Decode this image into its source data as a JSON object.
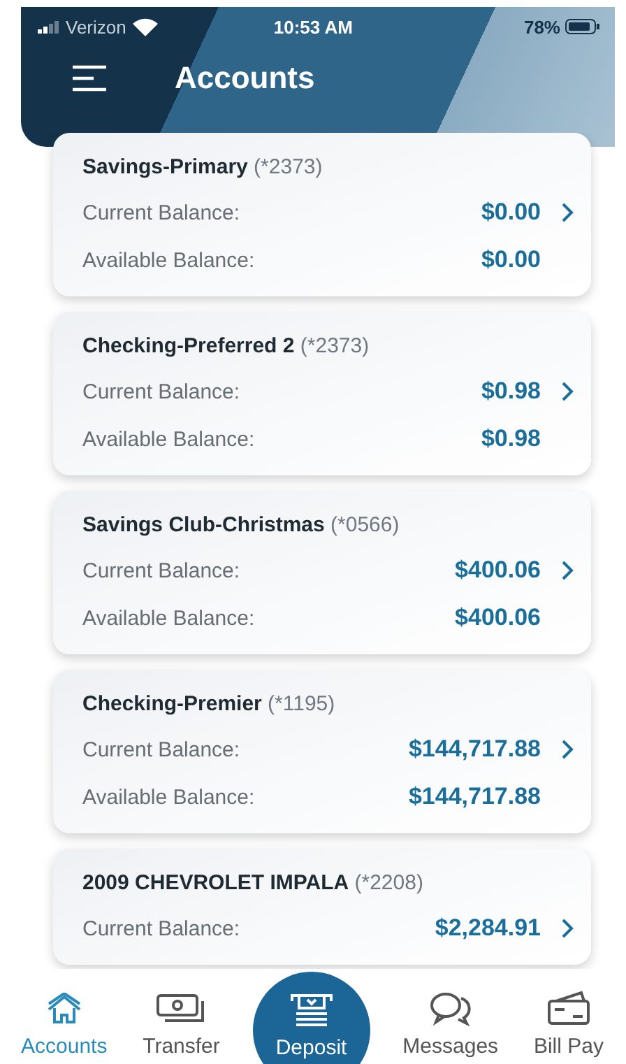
{
  "status_bar": {
    "carrier": "Verizon",
    "time": "10:53 AM",
    "battery": "78%"
  },
  "header": {
    "title": "Accounts"
  },
  "accounts": [
    {
      "title": "**Savings-Primary** (*2373)",
      "current_label": "Current Balance:",
      "current": "$0.00",
      "available_label": "Available Balance:",
      "available": "$0.00"
    },
    {
      "title": "**Checking-Preferred 2** (*2373)",
      "current_label": "Current Balance:",
      "current": "$0.98",
      "available_label": "Available Balance:",
      "available": "$0.98"
    },
    {
      "title": "**Savings Club-Christmas** (*0566)",
      "current_label": "Current Balance:",
      "current": "$400.06",
      "available_label": "Available Balance:",
      "available": "$400.06"
    },
    {
      "title": "**Checking-Premier** (*1195)",
      "current_label": "Current Balance:",
      "current": "$144,717.88",
      "available_label": "Available Balance:",
      "available": "$144,717.88"
    },
    {
      "title": "**2009 CHEVROLET IMPALA** (*2208)",
      "current_label": "Current Balance:",
      "current": "$2,284.91"
    }
  ],
  "tab_bar": [
    {
      "kind": "home",
      "label": "Accounts",
      "selected": true
    },
    {
      "kind": "cash",
      "label": "Transfer",
      "selected": false
    },
    {
      "kind": "deposit",
      "label": "Deposit",
      "selected": false
    },
    {
      "kind": "chat",
      "label": "Messages",
      "selected": false
    },
    {
      "kind": "card",
      "label": "Bill Pay",
      "selected": false
    }
  ]
}
